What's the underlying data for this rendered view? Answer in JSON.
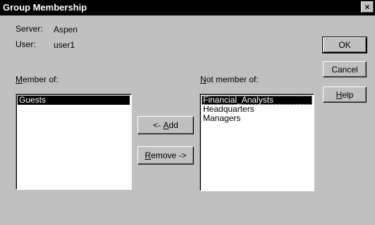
{
  "window": {
    "title": "Group Membership",
    "close_glyph": "×"
  },
  "info": {
    "server_label": "Server:",
    "server_value": "Aspen",
    "user_label": "User:",
    "user_value": "user1"
  },
  "member_of": {
    "label_mnemonic": "M",
    "label_rest": "ember of:",
    "items": [
      "Guests"
    ],
    "selected_index": 0
  },
  "not_member_of": {
    "label_mnemonic": "N",
    "label_rest": "ot member of:",
    "items": [
      "Financial_Analysts",
      "Headquarters",
      "Managers"
    ],
    "selected_index": 0
  },
  "buttons": {
    "add_prefix": "<- ",
    "add_mnemonic": "A",
    "add_rest": "dd",
    "remove_mnemonic": "R",
    "remove_rest": "emove ->",
    "ok": "OK",
    "cancel": "Cancel",
    "help_mnemonic": "H",
    "help_rest": "elp"
  }
}
